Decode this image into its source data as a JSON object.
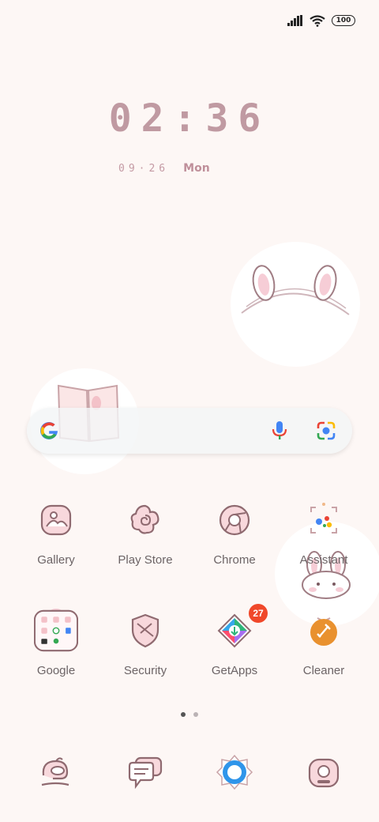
{
  "status_bar": {
    "battery": "100",
    "signal_icon": "signal-icon",
    "wifi_icon": "wifi-icon"
  },
  "lockclock": {
    "time": "02:36",
    "date": "09·26",
    "weekday": "Mon"
  },
  "search_bar": {
    "google_icon": "google-g-icon",
    "mic_icon": "mic-icon",
    "lens_icon": "lens-icon"
  },
  "apps": [
    {
      "label": "Gallery",
      "icon": "gallery-icon"
    },
    {
      "label": "Play Store",
      "icon": "play-store-icon"
    },
    {
      "label": "Chrome",
      "icon": "chrome-icon"
    },
    {
      "label": "Assistant",
      "icon": "assistant-icon"
    },
    {
      "label": "Google",
      "icon": "google-folder-icon"
    },
    {
      "label": "Security",
      "icon": "security-icon"
    },
    {
      "label": "GetApps",
      "icon": "getapps-icon",
      "badge": "27"
    },
    {
      "label": "Cleaner",
      "icon": "cleaner-icon"
    }
  ],
  "page_indicator": {
    "pages": 2,
    "active": 1
  },
  "dock": [
    "phone-icon",
    "messages-icon",
    "browser-icon",
    "camera-icon"
  ]
}
